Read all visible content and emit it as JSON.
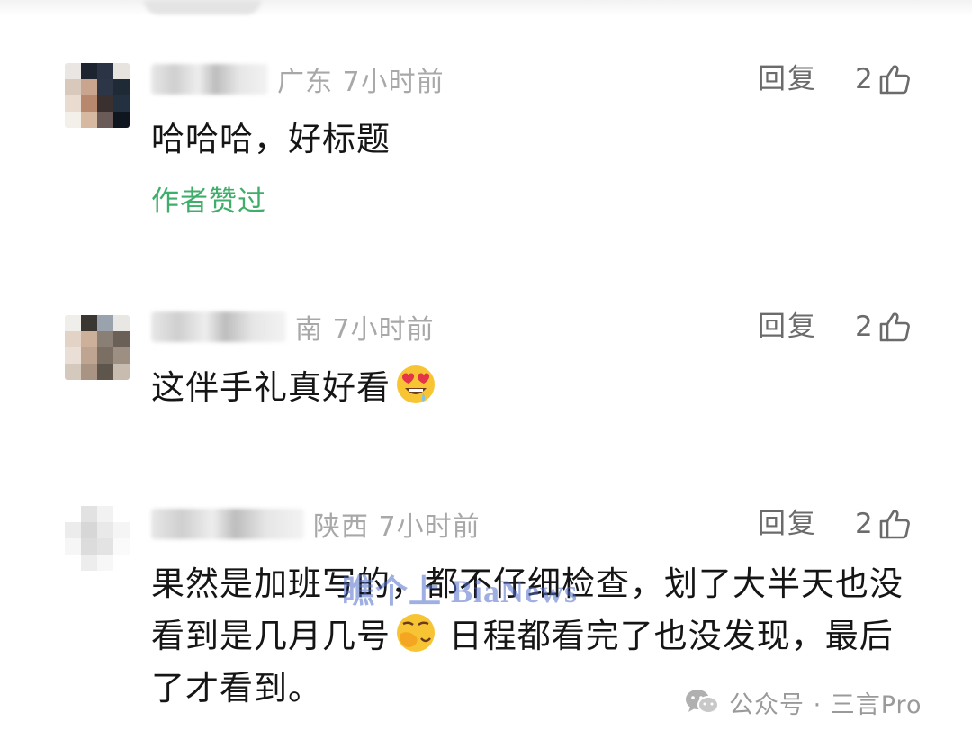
{
  "comments": [
    {
      "region_time": "广东 7小时前",
      "reply_label": "回复",
      "likes": "2",
      "text": "哈哈哈，好标题",
      "author_liked": "作者赞过"
    },
    {
      "region_time": "南 7小时前",
      "reply_label": "回复",
      "likes": "2",
      "text": "这伴手礼真好看",
      "emoji": "heart-eyes-emoji"
    },
    {
      "region_time": "陕西 7小时前",
      "reply_label": "回复",
      "likes": "2",
      "text": "果然是加班写的，都不仔细检查，划了大半天也没看到是几月几号",
      "emoji": "facepalm-emoji",
      "text_after": " 日程都看完了也没发现，最后了才看到。"
    }
  ],
  "watermark": "瞧个上 BiaNews",
  "source": "公众号 · 三言Pro",
  "colors": {
    "author_liked": "#3fae6a",
    "meta_gray": "#a8a8a8",
    "action_gray": "#6b6b6b"
  }
}
